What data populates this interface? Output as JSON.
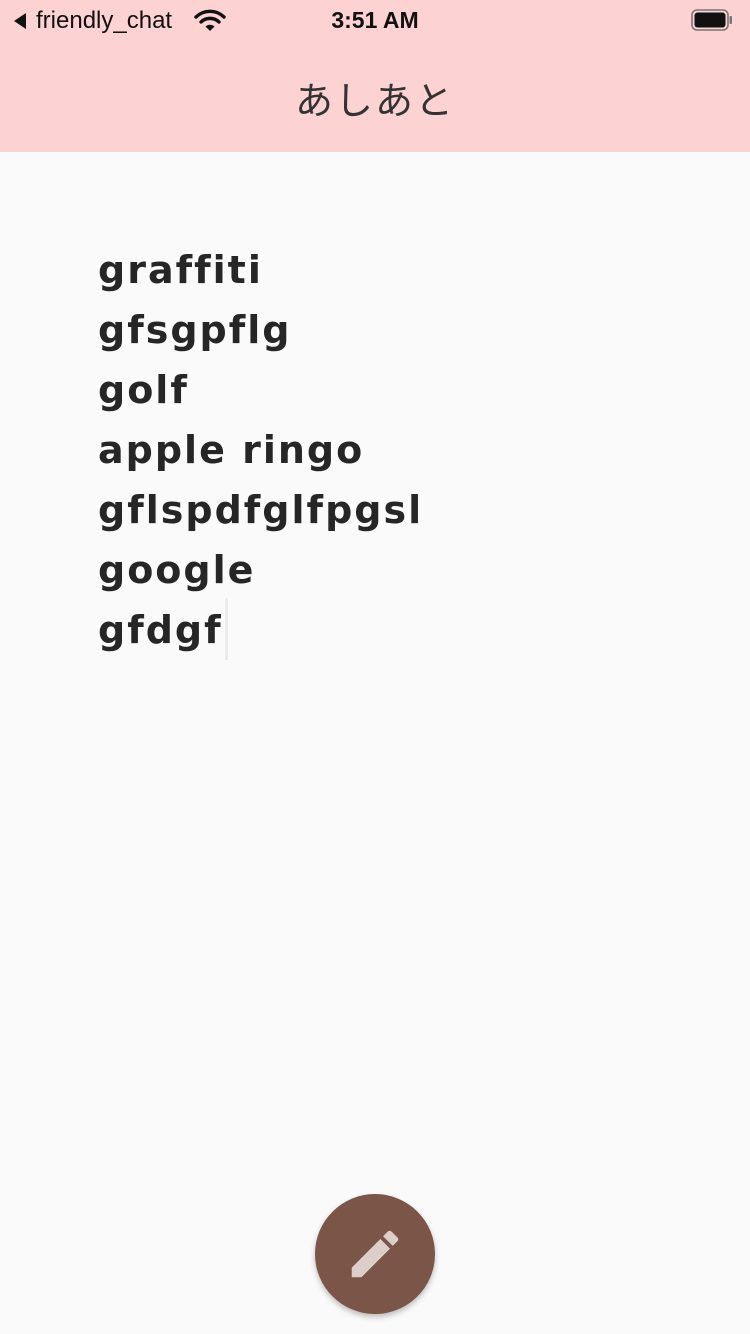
{
  "status_bar": {
    "back_app": "friendly_chat",
    "time": "3:51 AM",
    "icons": [
      "back-caret-icon",
      "wifi-icon",
      "battery-icon"
    ]
  },
  "app_bar": {
    "title": "あしあと"
  },
  "words": [
    "graffiti",
    "gfsgpflg",
    "golf",
    "apple ringo",
    "gflspdfglfpgsl",
    "google",
    "gfdgf"
  ],
  "fab": {
    "icon": "pencil-icon"
  },
  "colors": {
    "app_bar": "#fcd2d2",
    "background": "#fafafa",
    "fab": "#7a5548",
    "fab_icon": "#dccfca",
    "text": "#262626"
  }
}
